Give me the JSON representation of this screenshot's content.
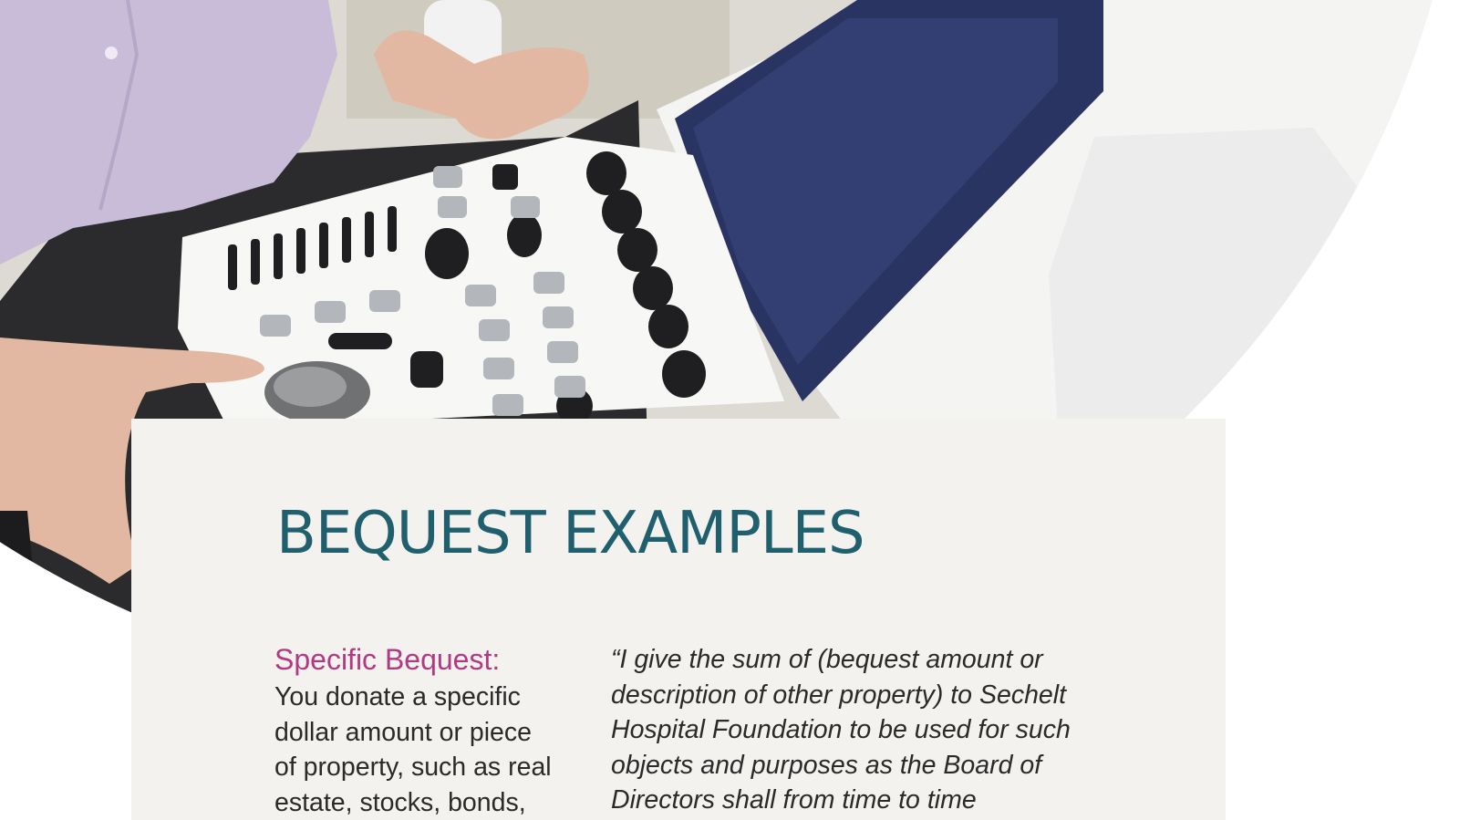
{
  "photo": {
    "alt_subject": "ultrasound machine control panel",
    "colors": {
      "shirt": "#c9bcd9",
      "machine_white": "#f4f4f3",
      "panel_dark": "#2b2b2e",
      "screen": "#2a3463",
      "skin": "#e3b8a2"
    }
  },
  "section": {
    "title": "BEQUEST EXAMPLES",
    "label": "Specific Bequest:",
    "description": "You donate a specific dollar amount or piece of property, such as real estate, stocks, bonds,",
    "quote": "“I give the sum of (bequest amount or description of other property) to Sechelt Hospital Foundation to be used for such objects and purposes as the Board of Directors shall from time to time"
  },
  "colors": {
    "title": "#1f5f6e",
    "label": "#b23a82",
    "card_bg": "#f3f2ee"
  }
}
